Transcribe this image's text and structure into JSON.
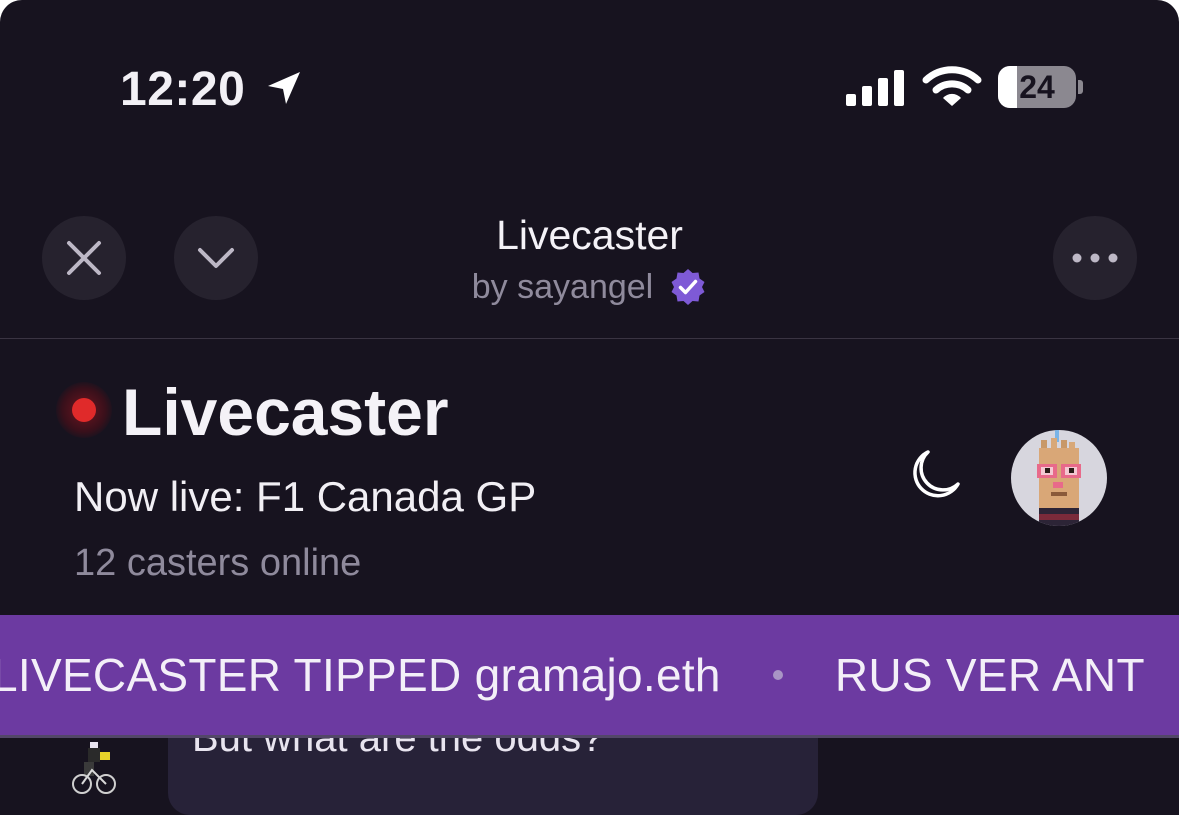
{
  "status_bar": {
    "time": "12:20",
    "battery_level": "24",
    "battery_fraction": 0.24,
    "icons": [
      "location-arrow-icon",
      "cellular-signal-icon",
      "wifi-icon",
      "battery-icon"
    ]
  },
  "header": {
    "title": "Livecaster",
    "byline": "by sayangel",
    "buttons": [
      "close-icon",
      "chevron-down-icon",
      "more-horizontal-icon"
    ],
    "verified_icon": "verified-badge-icon",
    "accent": "#7e5ad6"
  },
  "hero": {
    "title": "Livecaster",
    "now_live": "Now live: F1 Canada GP",
    "casters_online": "12 casters online",
    "live_color": "#e02a2a",
    "theme_icon": "moon-icon",
    "avatar_icon": "pixel-avatar"
  },
  "ticker": {
    "items": [
      "LIVECASTER TIPPED gramajo.eth",
      "RUS VER ANT"
    ],
    "background": "#6c3aa1"
  },
  "chat": {
    "message": "But what are the odds?",
    "avatar_icon": "cyclist-avatar"
  }
}
